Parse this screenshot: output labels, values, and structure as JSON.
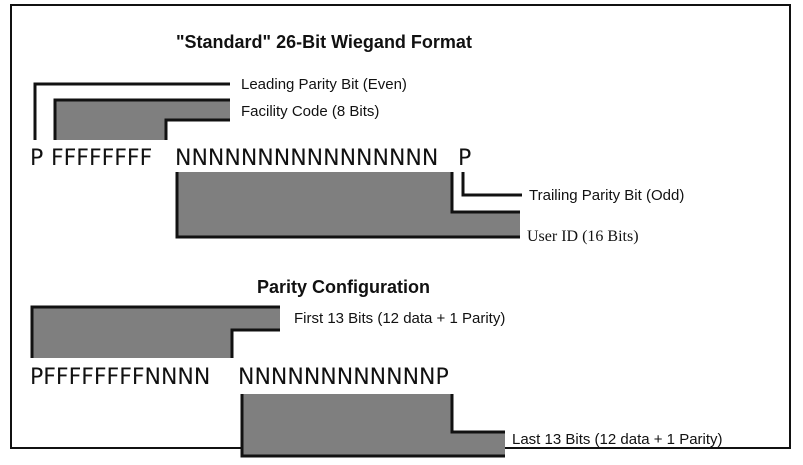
{
  "top_diagram": {
    "title": "\"Standard\" 26-Bit Wiegand Format",
    "labels": {
      "leading_parity": "Leading Parity Bit (Even)",
      "facility_code": "Facility Code (8 Bits)",
      "trailing_parity": "Trailing Parity Bit (Odd)",
      "user_id": "User ID (16 Bits)"
    },
    "bitstring": {
      "leading_p": "P",
      "facility": "FFFFFFFF",
      "user": "NNNNNNNNNNNNNNNN",
      "trailing_p": "P"
    }
  },
  "bottom_diagram": {
    "title": "Parity Configuration",
    "labels": {
      "first_13": "First 13 Bits (12 data + 1 Parity)",
      "last_13": "Last 13 Bits (12 data + 1 Parity)"
    },
    "bitstring": {
      "first_half": "PFFFFFFFFNNNN",
      "second_half": "NNNNNNNNNNNNP"
    }
  },
  "colors": {
    "shade": "#7f7f7f",
    "line": "#111111"
  }
}
